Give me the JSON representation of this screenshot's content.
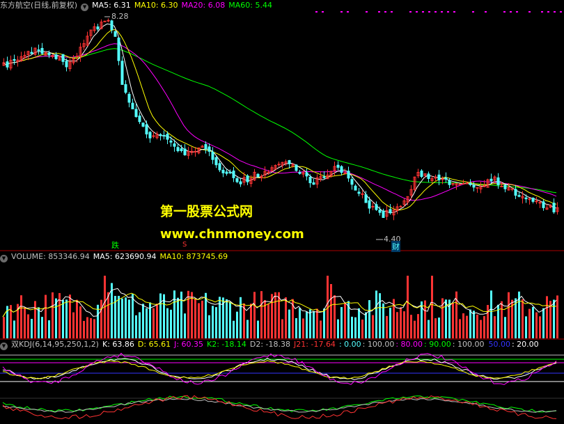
{
  "price_header": {
    "symbol": "东方航空(日线,前复权)",
    "ma5": "MA5: 6.31",
    "ma10": "MA10: 6.30",
    "ma20": "MA20: 6.08",
    "ma60": "MA60: 5.44"
  },
  "volume_header": {
    "volume": "VOLUME: 853346.94",
    "ma5": "MA5: 623690.94",
    "ma10": "MA10: 873745.69"
  },
  "kdj_header": {
    "name": "双KDJ(6,14,95,250,1,2)",
    "k": "K: 63.86",
    "d": "D: 65.61",
    "j": "J: 60.35",
    "k2": "K2: -18.14",
    "d2": "D2: -18.38",
    "j21": "J21: -17.64",
    "l0": ": 0.00",
    "l100": ": 100.00",
    "l80": ": 80.00",
    "l90": ": 90.00",
    "l100b": ": 100.00",
    "l50": "50.00",
    "l20": ": 20.00"
  },
  "annotations": {
    "high": "8.28",
    "low": "4.40",
    "die": "跌",
    "s": "S",
    "cai": "财"
  },
  "watermark": {
    "line1": "第一股票公式网",
    "line2": "www.chnmoney.com"
  },
  "colors": {
    "up": "#ff3333",
    "down": "#54ffff",
    "ma5": "#ffffff",
    "ma10": "#ffff00",
    "ma20": "#ff00ff",
    "ma60": "#00ff00"
  }
}
